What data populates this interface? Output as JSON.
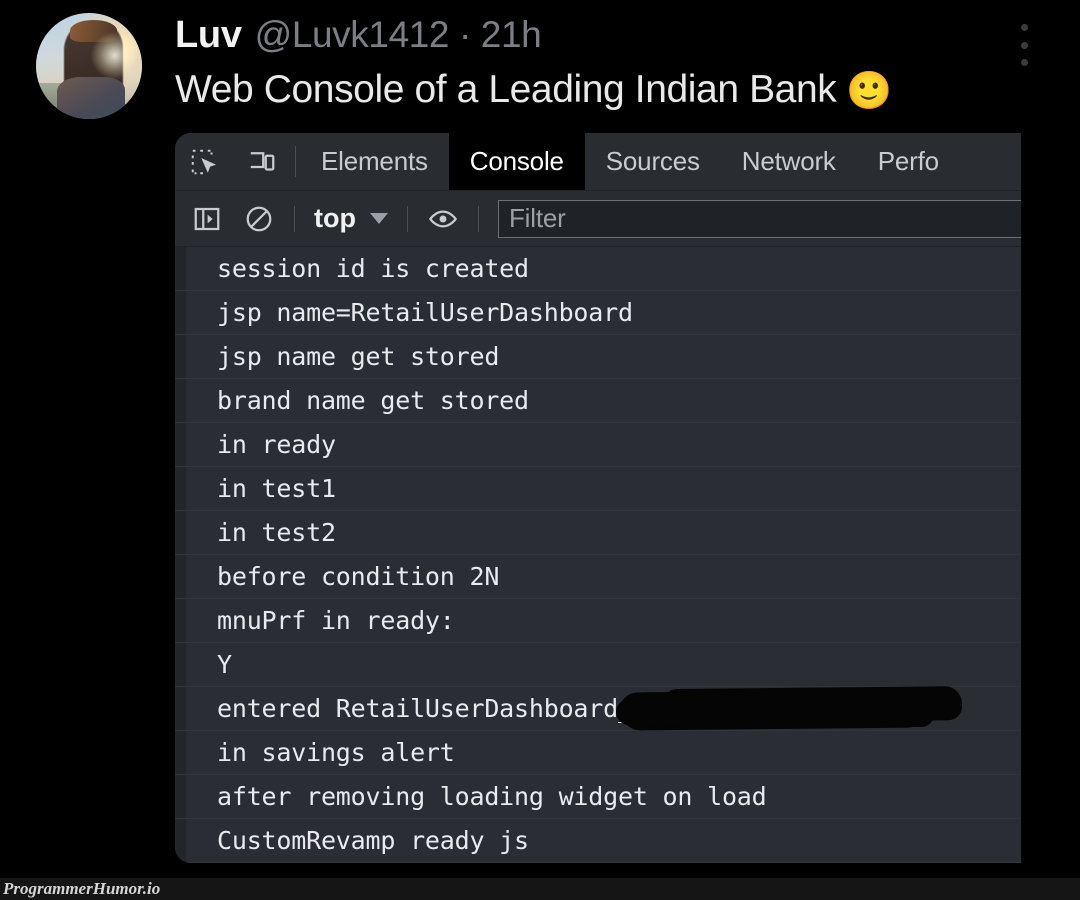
{
  "tweet": {
    "avatar_name": "user-avatar-photo",
    "display_name": "Luv",
    "handle_and_time": "@Luvk1412 · 21h",
    "body_text": "Web Console of a Leading Indian Bank",
    "body_emoji": "🙂",
    "more_menu_name": "more-options"
  },
  "devtools": {
    "tabs": [
      {
        "label": "Elements",
        "active": false
      },
      {
        "label": "Console",
        "active": true
      },
      {
        "label": "Sources",
        "active": false
      },
      {
        "label": "Network",
        "active": false
      },
      {
        "label": "Perfo",
        "active": false
      }
    ],
    "tab_icons": [
      "inspect-element-icon",
      "device-toolbar-icon"
    ],
    "toolbar": {
      "sidebar_toggle": "console-sidebar-toggle-icon",
      "clear_console": "clear-console-icon",
      "context_value": "top",
      "context_caret": "chevron-down-icon",
      "eye_icon": "live-expression-eye-icon",
      "filter_placeholder": "Filter",
      "filter_value": ""
    },
    "logs": [
      {
        "text": "session id is created",
        "redacted": false
      },
      {
        "text": "jsp name=RetailUserDashboard",
        "redacted": false
      },
      {
        "text": "jsp name get stored",
        "redacted": false
      },
      {
        "text": "brand name get stored",
        "redacted": false
      },
      {
        "text": "in ready",
        "redacted": false
      },
      {
        "text": "in test1",
        "redacted": false
      },
      {
        "text": "in test2",
        "redacted": false
      },
      {
        "text": "before condition 2N",
        "redacted": false
      },
      {
        "text": "mnuPrf in ready:",
        "redacted": false
      },
      {
        "text": "Y",
        "redacted": false
      },
      {
        "text": "entered RetailUserDashboard_",
        "redacted": true
      },
      {
        "text": "in savings alert",
        "redacted": false
      },
      {
        "text": "after removing loading widget on load",
        "redacted": false
      },
      {
        "text": "CustomRevamp ready js",
        "redacted": false
      }
    ]
  },
  "watermark": {
    "text": "ProgrammerHumor.io"
  },
  "colors": {
    "page_background": "#000000",
    "panel_background": "#292c31",
    "console_row": "#2a2d33",
    "active_tab_background": "#000000",
    "tab_text": "#c8ccd0",
    "log_text": "#e8eaed",
    "handle_text": "#7b7f85"
  }
}
